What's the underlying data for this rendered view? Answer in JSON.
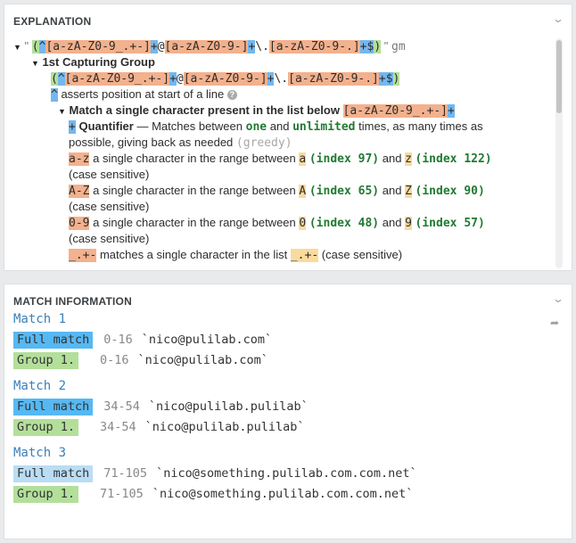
{
  "explanation": {
    "title": "EXPLANATION",
    "quote_open": "\"",
    "quote_close": "\"",
    "flags": "gm",
    "regex_parts": {
      "open": "(",
      "caret": "^",
      "cls1": "[a-zA-Z0-9_.+-]",
      "plus": "+",
      "at": "@",
      "cls2": "[a-zA-Z0-9-]",
      "dot": "\\.",
      "cls3": "[a-zA-Z0-9-.]",
      "plus_end": "+$",
      "close": ")"
    },
    "group_heading": "1st Capturing Group",
    "anchor_text": "asserts position at start of a line",
    "help_icon": "?",
    "match_single_bold": "Match a single character present in the list below",
    "quantifier_bold": "Quantifier",
    "quantifier_text1": "— Matches between",
    "one": "one",
    "and": "and",
    "unlimited": "unlimited",
    "quantifier_text2": "times, as many times as",
    "quantifier_text3": "possible, giving back as needed",
    "greedy": "(greedy)",
    "ranges": [
      {
        "token": "a-z",
        "text": "a single character in the range between",
        "from": "a",
        "from_idx": "(index 97)",
        "to": "z",
        "to_idx": "(index 122)"
      },
      {
        "token": "A-Z",
        "text": "a single character in the range between",
        "from": "A",
        "from_idx": "(index 65)",
        "to": "Z",
        "to_idx": "(index 90)"
      },
      {
        "token": "0-9",
        "text": "a single character in the range between",
        "from": "0",
        "from_idx": "(index 48)",
        "to": "9",
        "to_idx": "(index 57)"
      }
    ],
    "case_sensitive": "(case sensitive)",
    "list_token": "_.+-",
    "list_text": "matches a single character in the list",
    "list_chars": "_.+-",
    "list_case": "(case sensitive)"
  },
  "match_info": {
    "title": "MATCH INFORMATION",
    "matches": [
      {
        "title": "Match 1",
        "rows": [
          {
            "label": "Full match",
            "range": "0-16",
            "value": "`nico@pulilab.com`"
          },
          {
            "label": "Group 1.",
            "range": "0-16",
            "value": "`nico@pulilab.com`"
          }
        ]
      },
      {
        "title": "Match 2",
        "rows": [
          {
            "label": "Full match",
            "range": "34-54",
            "value": "`nico@pulilab.pulilab`"
          },
          {
            "label": "Group 1.",
            "range": "34-54",
            "value": "`nico@pulilab.pulilab`"
          }
        ]
      },
      {
        "title": "Match 3",
        "rows": [
          {
            "label": "Full match",
            "range": "71-105",
            "value": "`nico@something.pulilab.com.com.net`"
          },
          {
            "label": "Group 1.",
            "range": "71-105",
            "value": "`nico@something.pulilab.com.com.net`"
          }
        ]
      }
    ]
  }
}
